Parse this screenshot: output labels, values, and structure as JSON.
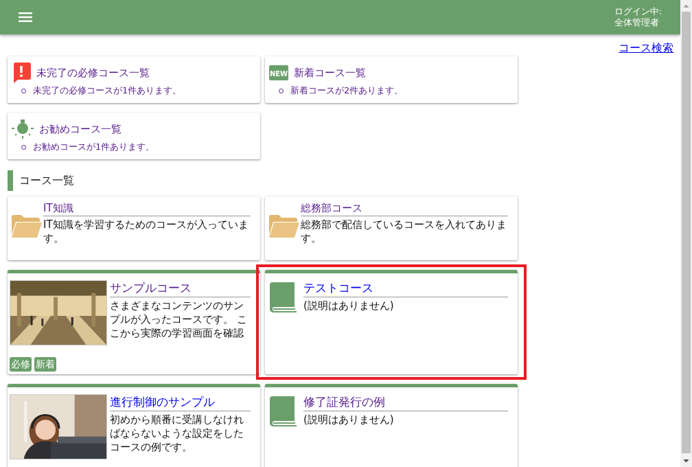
{
  "header": {
    "login_label": "ログイン中:",
    "user_name": "全体管理者"
  },
  "search_link": {
    "label": "コース検索",
    "visited": false
  },
  "notices": [
    {
      "kind": "required",
      "title": "未完了の必修コース一覧",
      "visited": true,
      "items": [
        "未完了の必修コースが1件あります。"
      ]
    },
    {
      "kind": "new",
      "badge": "NEW",
      "title": "新着コース一覧",
      "visited": true,
      "items": [
        "新着コースが2件あります。"
      ]
    },
    {
      "kind": "recommended",
      "title": "お勧めコース一覧",
      "visited": true,
      "items": [
        "お勧めコースが1件あります。"
      ]
    }
  ],
  "section_title": "コース一覧",
  "categories": [
    {
      "title": "IT知識",
      "visited": true,
      "description": "IT知識を学習するためのコースが入っています。"
    },
    {
      "title": "総務部コース",
      "visited": true,
      "description": "総務部で配信しているコースを入れてあります。"
    }
  ],
  "courses": [
    {
      "title": "サンプルコース",
      "visited": true,
      "kind": "picture",
      "description": "さまざまなコンテンツのサンプルが入ったコースです。 ここから実際の学習画面を確認",
      "tags": [
        "必修",
        "新着"
      ],
      "highlighted": false
    },
    {
      "title": "テストコース",
      "visited": false,
      "kind": "book",
      "description": "(説明はありません)",
      "highlighted": true
    },
    {
      "title": "進行制御のサンプル",
      "visited": false,
      "kind": "picture",
      "description": "初めから順番に受講しなければならないような設定をしたコースの例です。",
      "highlighted": false
    },
    {
      "title": "修了証発行の例",
      "visited": true,
      "kind": "book",
      "description": "(説明はありません)",
      "highlighted": false
    }
  ]
}
